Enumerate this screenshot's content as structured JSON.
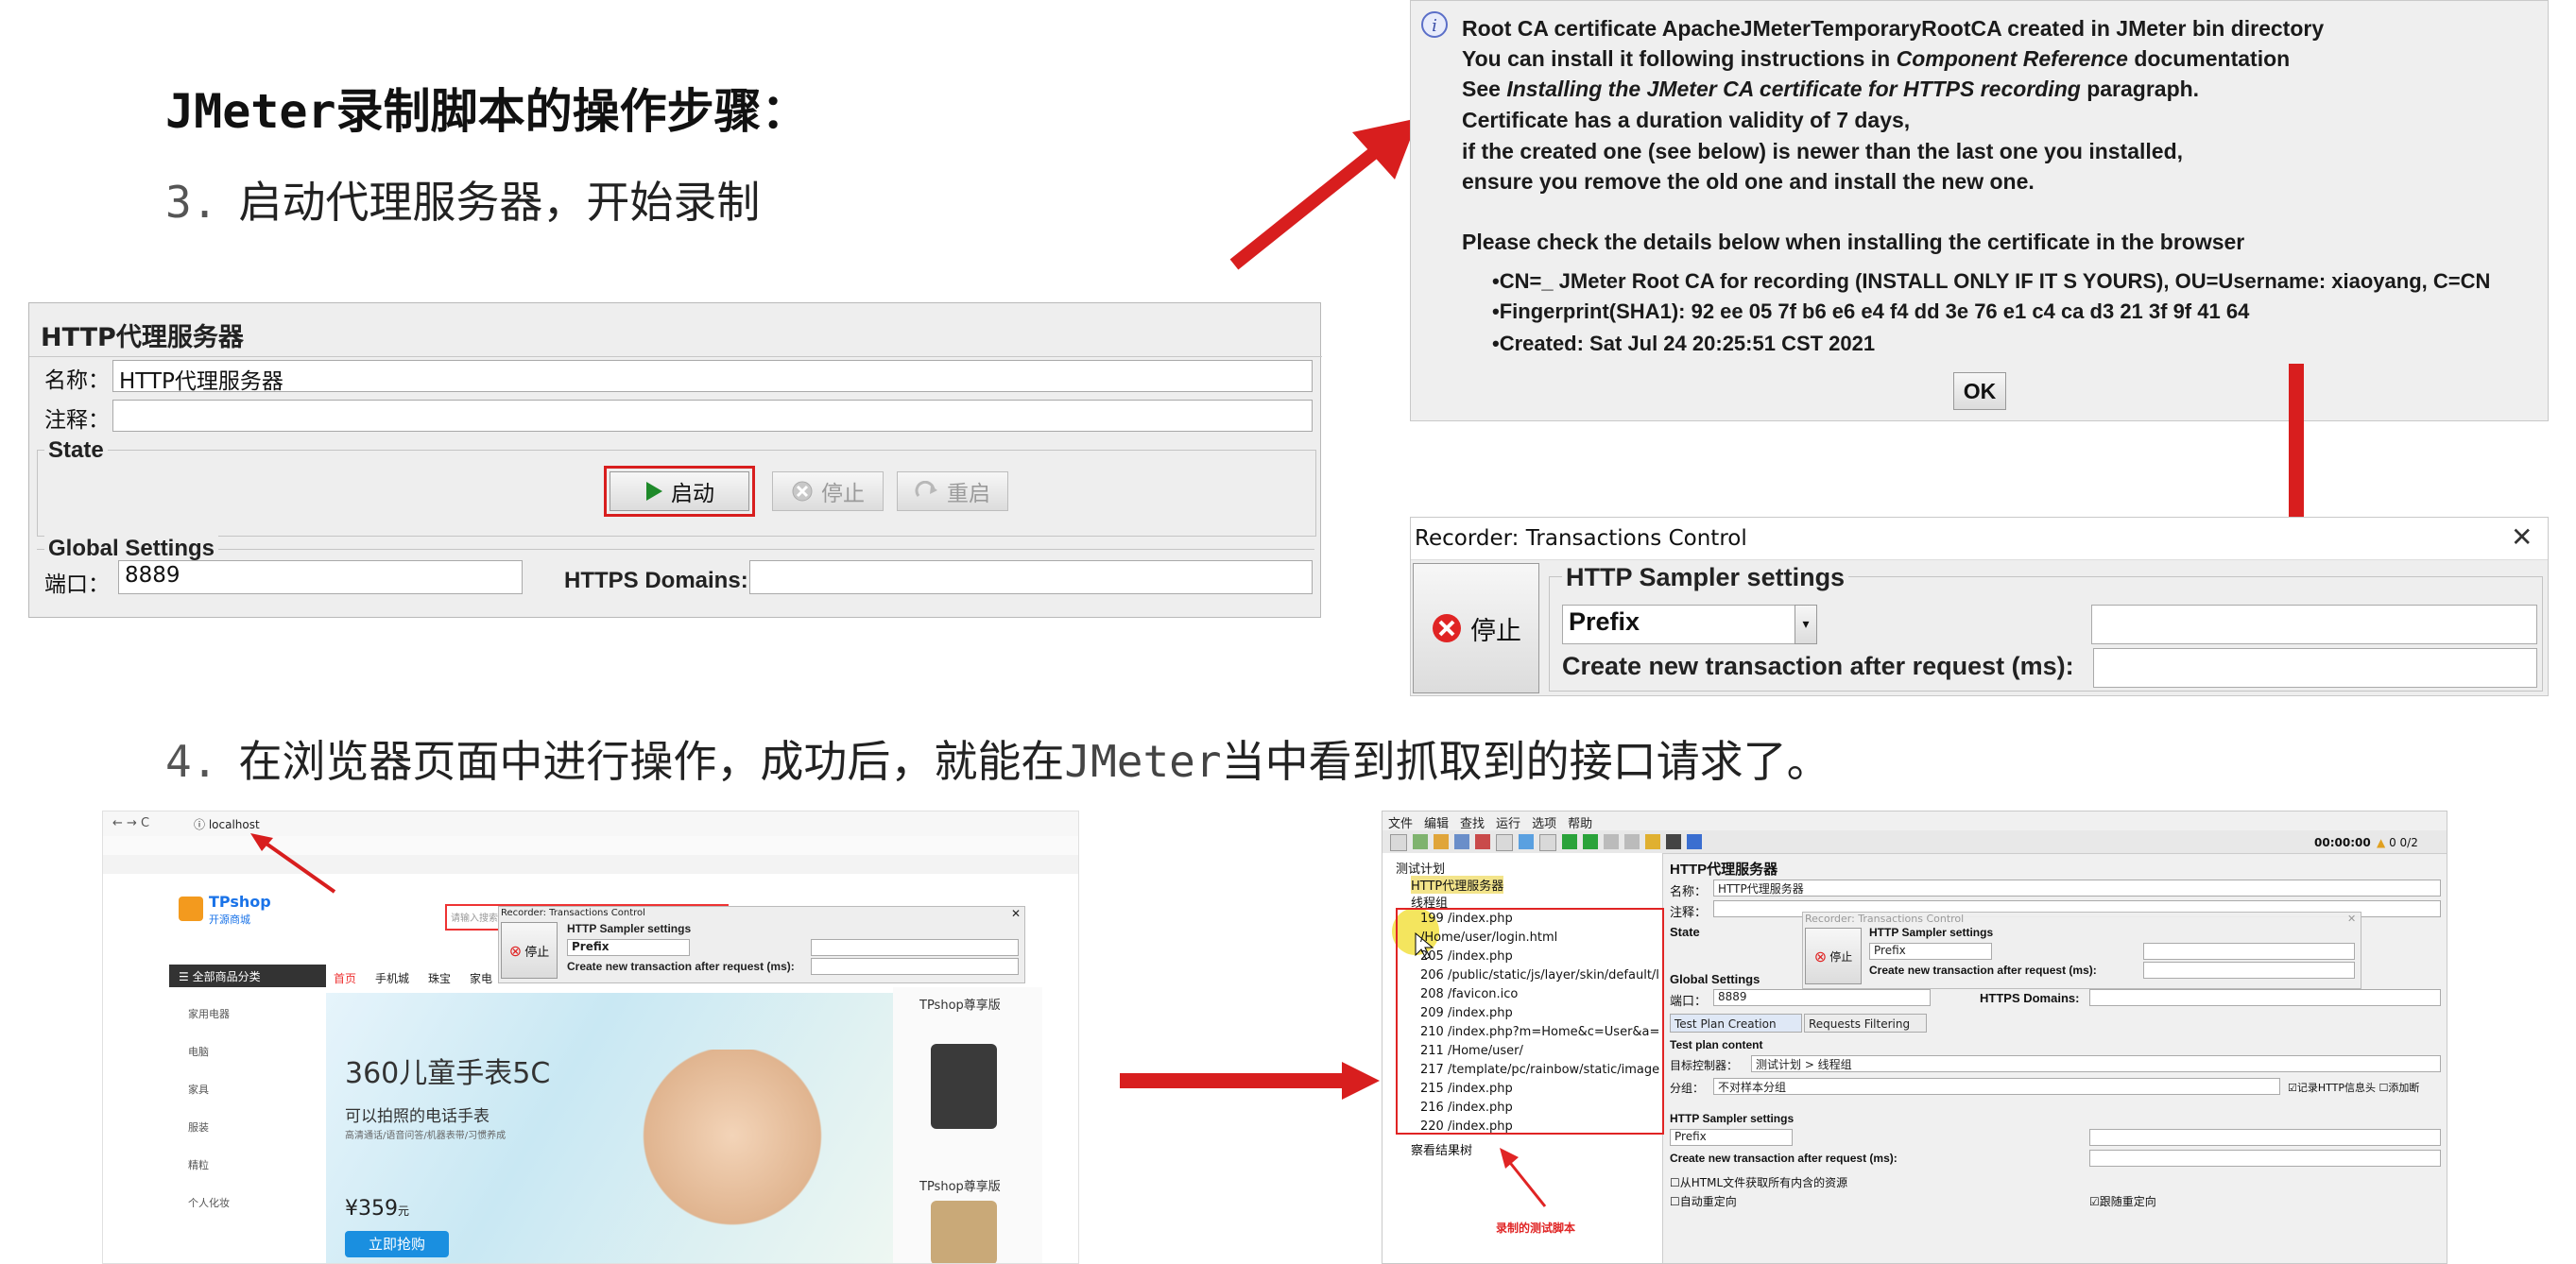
{
  "heading": {
    "prefix": "JMeter",
    "rest": "录制脚本的操作步骤："
  },
  "step3": {
    "num": "3.",
    "text": "启动代理服务器，开始录制"
  },
  "step4": {
    "num": "4.",
    "text_a": "在浏览器页面中进行操作，成功后，就能在",
    "mono": "JMeter",
    "text_b": "当中看到抓取到的接口请求了。"
  },
  "proxy_panel": {
    "title": "HTTP代理服务器",
    "name_label": "名称：",
    "name_value": "HTTP代理服务器",
    "comment_label": "注释：",
    "state_label": "State",
    "start_label": "启动",
    "stop_label": "停止",
    "restart_label": "重启",
    "global_label": "Global Settings",
    "port_label": "端口：",
    "port_value": "8889",
    "https_label": "HTTPS Domains:"
  },
  "dialog": {
    "lines": [
      "Root CA certificate ApacheJMeterTemporaryRootCA created in JMeter bin directory",
      "You can install it following instructions in ",
      "Component Reference",
      " documentation",
      "See ",
      "Installing the JMeter CA certificate for HTTPS recording",
      " paragraph.",
      "Certificate has a duration validity of 7 days,",
      "if the created one (see below) is newer than the last one you installed,",
      "ensure you remove the old one and install the new one.",
      "Please check the details below when installing the certificate in the browser"
    ],
    "bullets": [
      "CN=_ JMeter Root CA for recording (INSTALL ONLY IF IT S YOURS), OU=Username: xiaoyang, C=CN",
      "Fingerprint(SHA1): 92 ee 05 7f b6 e6 e4 f4 dd 3e 76 e1 c4 ca d3 21 3f 9f 41 64",
      "Created: Sat Jul 24 20:25:51 CST 2021"
    ],
    "ok_label": "OK",
    "info_icon": "info-icon"
  },
  "recorder": {
    "title": "Recorder: Transactions Control",
    "stop_label": "停止",
    "group_label": "HTTP Sampler settings",
    "prefix_value": "Prefix",
    "create_label": "Create new transaction after request (ms):"
  },
  "browser": {
    "url": "localhost",
    "logo": "TPshop",
    "logo_sub": "开源商城",
    "category_title": "全部商品分类",
    "categories": [
      "家用电器",
      "电脑",
      "家具",
      "服装",
      "精粒",
      "个人化妆"
    ],
    "nav": [
      "首页",
      "手机城",
      "珠宝",
      "家电"
    ],
    "banner_title": "360儿童手表5C",
    "banner_sub": "可以拍照的电话手表",
    "banner_desc": "高清通话/语音问答/机器表带/习惯养成",
    "price": "¥359",
    "price_unit": "元",
    "buy_label": "立即抢购",
    "badge": "TPshop尊享版",
    "badge2": "TPshop尊享版",
    "search_placeholder": "请输入搜索",
    "popup_title": "Recorder: Transactions Control",
    "popup_stop": "停止",
    "popup_group": "HTTP Sampler settings",
    "popup_prefix": "Prefix",
    "popup_create": "Create new transaction after request (ms):"
  },
  "jmeter": {
    "menu": [
      "文件",
      "编辑",
      "查找",
      "运行",
      "选项",
      "帮助"
    ],
    "timer": "00:00:00",
    "counter": "0 0/2",
    "tree": {
      "root": "测试计划",
      "proxy": "HTTP代理服务器",
      "thread_group": "线程组",
      "items": [
        "199 /index.php",
        "/Home/user/login.html",
        "205 /index.php",
        "206 /public/static/js/layer/skin/default/l",
        "208 /favicon.ico",
        "209 /index.php",
        "210 /index.php?m=Home&c=User&a=",
        "211 /Home/user/",
        "217 /template/pc/rainbow/static/image",
        "215 /index.php",
        "216 /index.php",
        "220 /index.php"
      ],
      "results": "察看结果树"
    },
    "annotation": "录制的测试脚本",
    "right": {
      "title": "HTTP代理服务器",
      "name_label": "名称：",
      "name_value": "HTTP代理服务器",
      "comment_label": "注释：",
      "state_label": "State",
      "global_label": "Global Settings",
      "port_label": "端口：",
      "port_value": "8889",
      "https_label": "HTTPS Domains:",
      "tab1": "Test Plan Creation",
      "tab2": "Requests Filtering",
      "plan_content": "Test plan content",
      "target_label": "目标控制器：",
      "target_value": "测试计划 > 线程组",
      "group_label": "分组：",
      "group_value": "不对样本分组",
      "record_headers": "记录HTTP信息头",
      "add_assert": "添加断",
      "sampler_settings": "HTTP Sampler settings",
      "prefix": "Prefix",
      "create_label": "Create new transaction after request (ms):",
      "retrieve": "从HTML文件获取所有内含的资源",
      "auto_redirect": "自动重定向",
      "follow_redirect": "跟随重定向"
    },
    "overlay": {
      "title": "Recorder: Transactions Control",
      "stop": "停止",
      "group": "HTTP Sampler settings",
      "prefix": "Prefix",
      "create": "Create new transaction after request (ms):"
    }
  },
  "colors": {
    "accent_red": "#d81e1e",
    "tpshop_blue": "#1a73e8",
    "tpshop_orange": "#f39a1e"
  }
}
